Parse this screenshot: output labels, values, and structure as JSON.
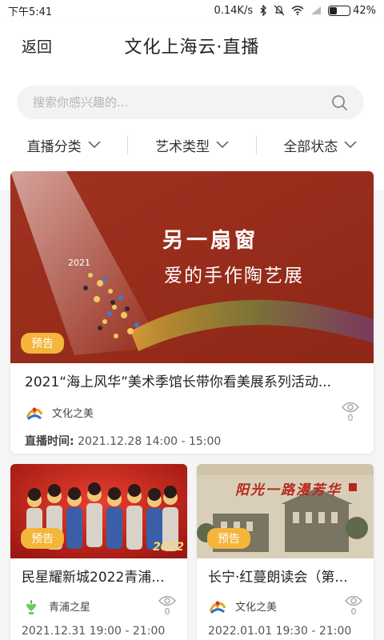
{
  "status_bar": {
    "time": "下午5:41",
    "network_speed": "0.14K/s",
    "battery": "42%",
    "battery_level": 0.42
  },
  "header": {
    "back_label": "返回",
    "title": "文化上海云·直播"
  },
  "search": {
    "placeholder": "搜索你感兴趣的..."
  },
  "filters": [
    {
      "label": "直播分类"
    },
    {
      "label": "艺术类型"
    },
    {
      "label": "全部状态"
    }
  ],
  "cards": [
    {
      "badge": "预告",
      "cover_title": "另一扇窗",
      "cover_subtitle": "爱的手作陶艺展",
      "cover_year": "2021",
      "title": "2021“海上风华”美术季馆长带你看美展系列活动...",
      "org": "文化之美",
      "views": "0",
      "time_label": "直播时间:",
      "time": "2021.12.28 14:00 - 15:00"
    },
    {
      "badge": "预告",
      "cover_year": "2022",
      "title": "民星耀新城2022青浦...",
      "org": "青浦之星",
      "views": "0",
      "time": "2021.12.31 19:00 - 21:00"
    },
    {
      "badge": "预告",
      "cover_title": "阳光一路漫芳华",
      "title": "长宁·红蔓朗读会（第...",
      "org": "文化之美",
      "views": "0",
      "time": "2022.01.01 19:30 - 21:00"
    }
  ],
  "colors": {
    "badge": "#f3b53a",
    "cover_red": "#9e2a1a",
    "accent_text": "#222222"
  }
}
